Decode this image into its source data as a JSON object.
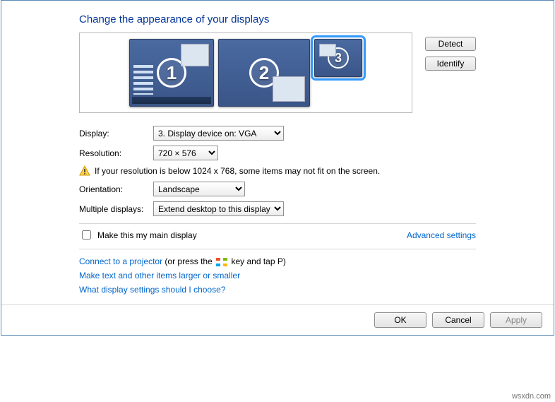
{
  "title": "Change the appearance of your displays",
  "preview": {
    "monitors": [
      {
        "number": "1",
        "selected": false
      },
      {
        "number": "2",
        "selected": false
      },
      {
        "number": "3",
        "selected": true
      }
    ],
    "buttons": {
      "detect": "Detect",
      "identify": "Identify"
    }
  },
  "form": {
    "display_label": "Display:",
    "display_value": "3. Display device on: VGA",
    "resolution_label": "Resolution:",
    "resolution_value": "720 × 576",
    "warning_text": "If your resolution is below 1024 x 768, some items may not fit on the screen.",
    "orientation_label": "Orientation:",
    "orientation_value": "Landscape",
    "multiple_label": "Multiple displays:",
    "multiple_value": "Extend desktop to this display"
  },
  "main_display": {
    "checkbox_label": "Make this my main display",
    "checked": false
  },
  "advanced_link": "Advanced settings",
  "links": {
    "projector_link": "Connect to a projector",
    "projector_suffix_pre": " (or press the ",
    "projector_suffix_post": " key and tap P)",
    "text_size": "Make text and other items larger or smaller",
    "help": "What display settings should I choose?"
  },
  "footer": {
    "ok": "OK",
    "cancel": "Cancel",
    "apply": "Apply"
  },
  "watermark": "wsxdn.com"
}
